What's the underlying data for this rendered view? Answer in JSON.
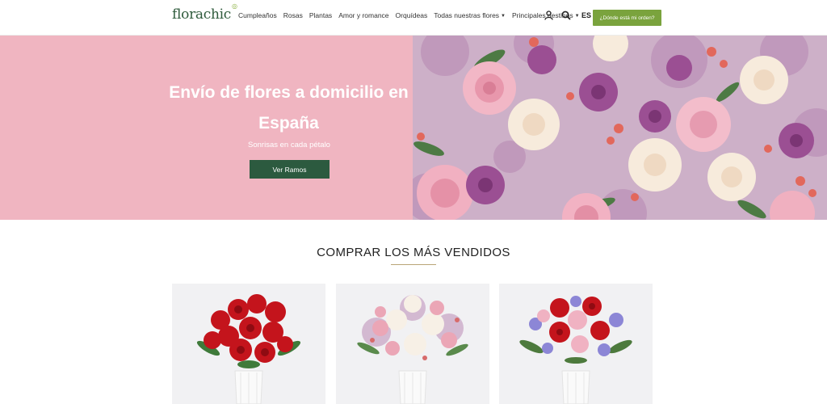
{
  "header": {
    "logo": "florachic",
    "nav": [
      {
        "label": "Cumpleaños"
      },
      {
        "label": "Rosas"
      },
      {
        "label": "Plantas"
      },
      {
        "label": "Amor y romance"
      },
      {
        "label": "Orquídeas"
      },
      {
        "label": "Todas nuestras flores",
        "has_caret": true
      },
      {
        "label": "Principales destinos",
        "has_caret": true
      }
    ],
    "language": "ES",
    "order_button": "¿Dónde está mi orden?"
  },
  "hero": {
    "title_line1": "Envío de flores a domicilio en",
    "title_line2": "España",
    "subtitle": "Sonrisas en cada pétalo",
    "button": "Ver Ramos"
  },
  "bestsellers": {
    "title": "COMPRAR LOS MÁS VENDIDOS",
    "products": [
      {
        "name": "red-roses-bouquet"
      },
      {
        "name": "mixed-pastel-bouquet"
      },
      {
        "name": "red-purple-bouquet"
      }
    ]
  },
  "colors": {
    "brand_green": "#2c5a3f",
    "accent_green": "#7aa33d",
    "hero_pink": "#f0b5c1"
  }
}
